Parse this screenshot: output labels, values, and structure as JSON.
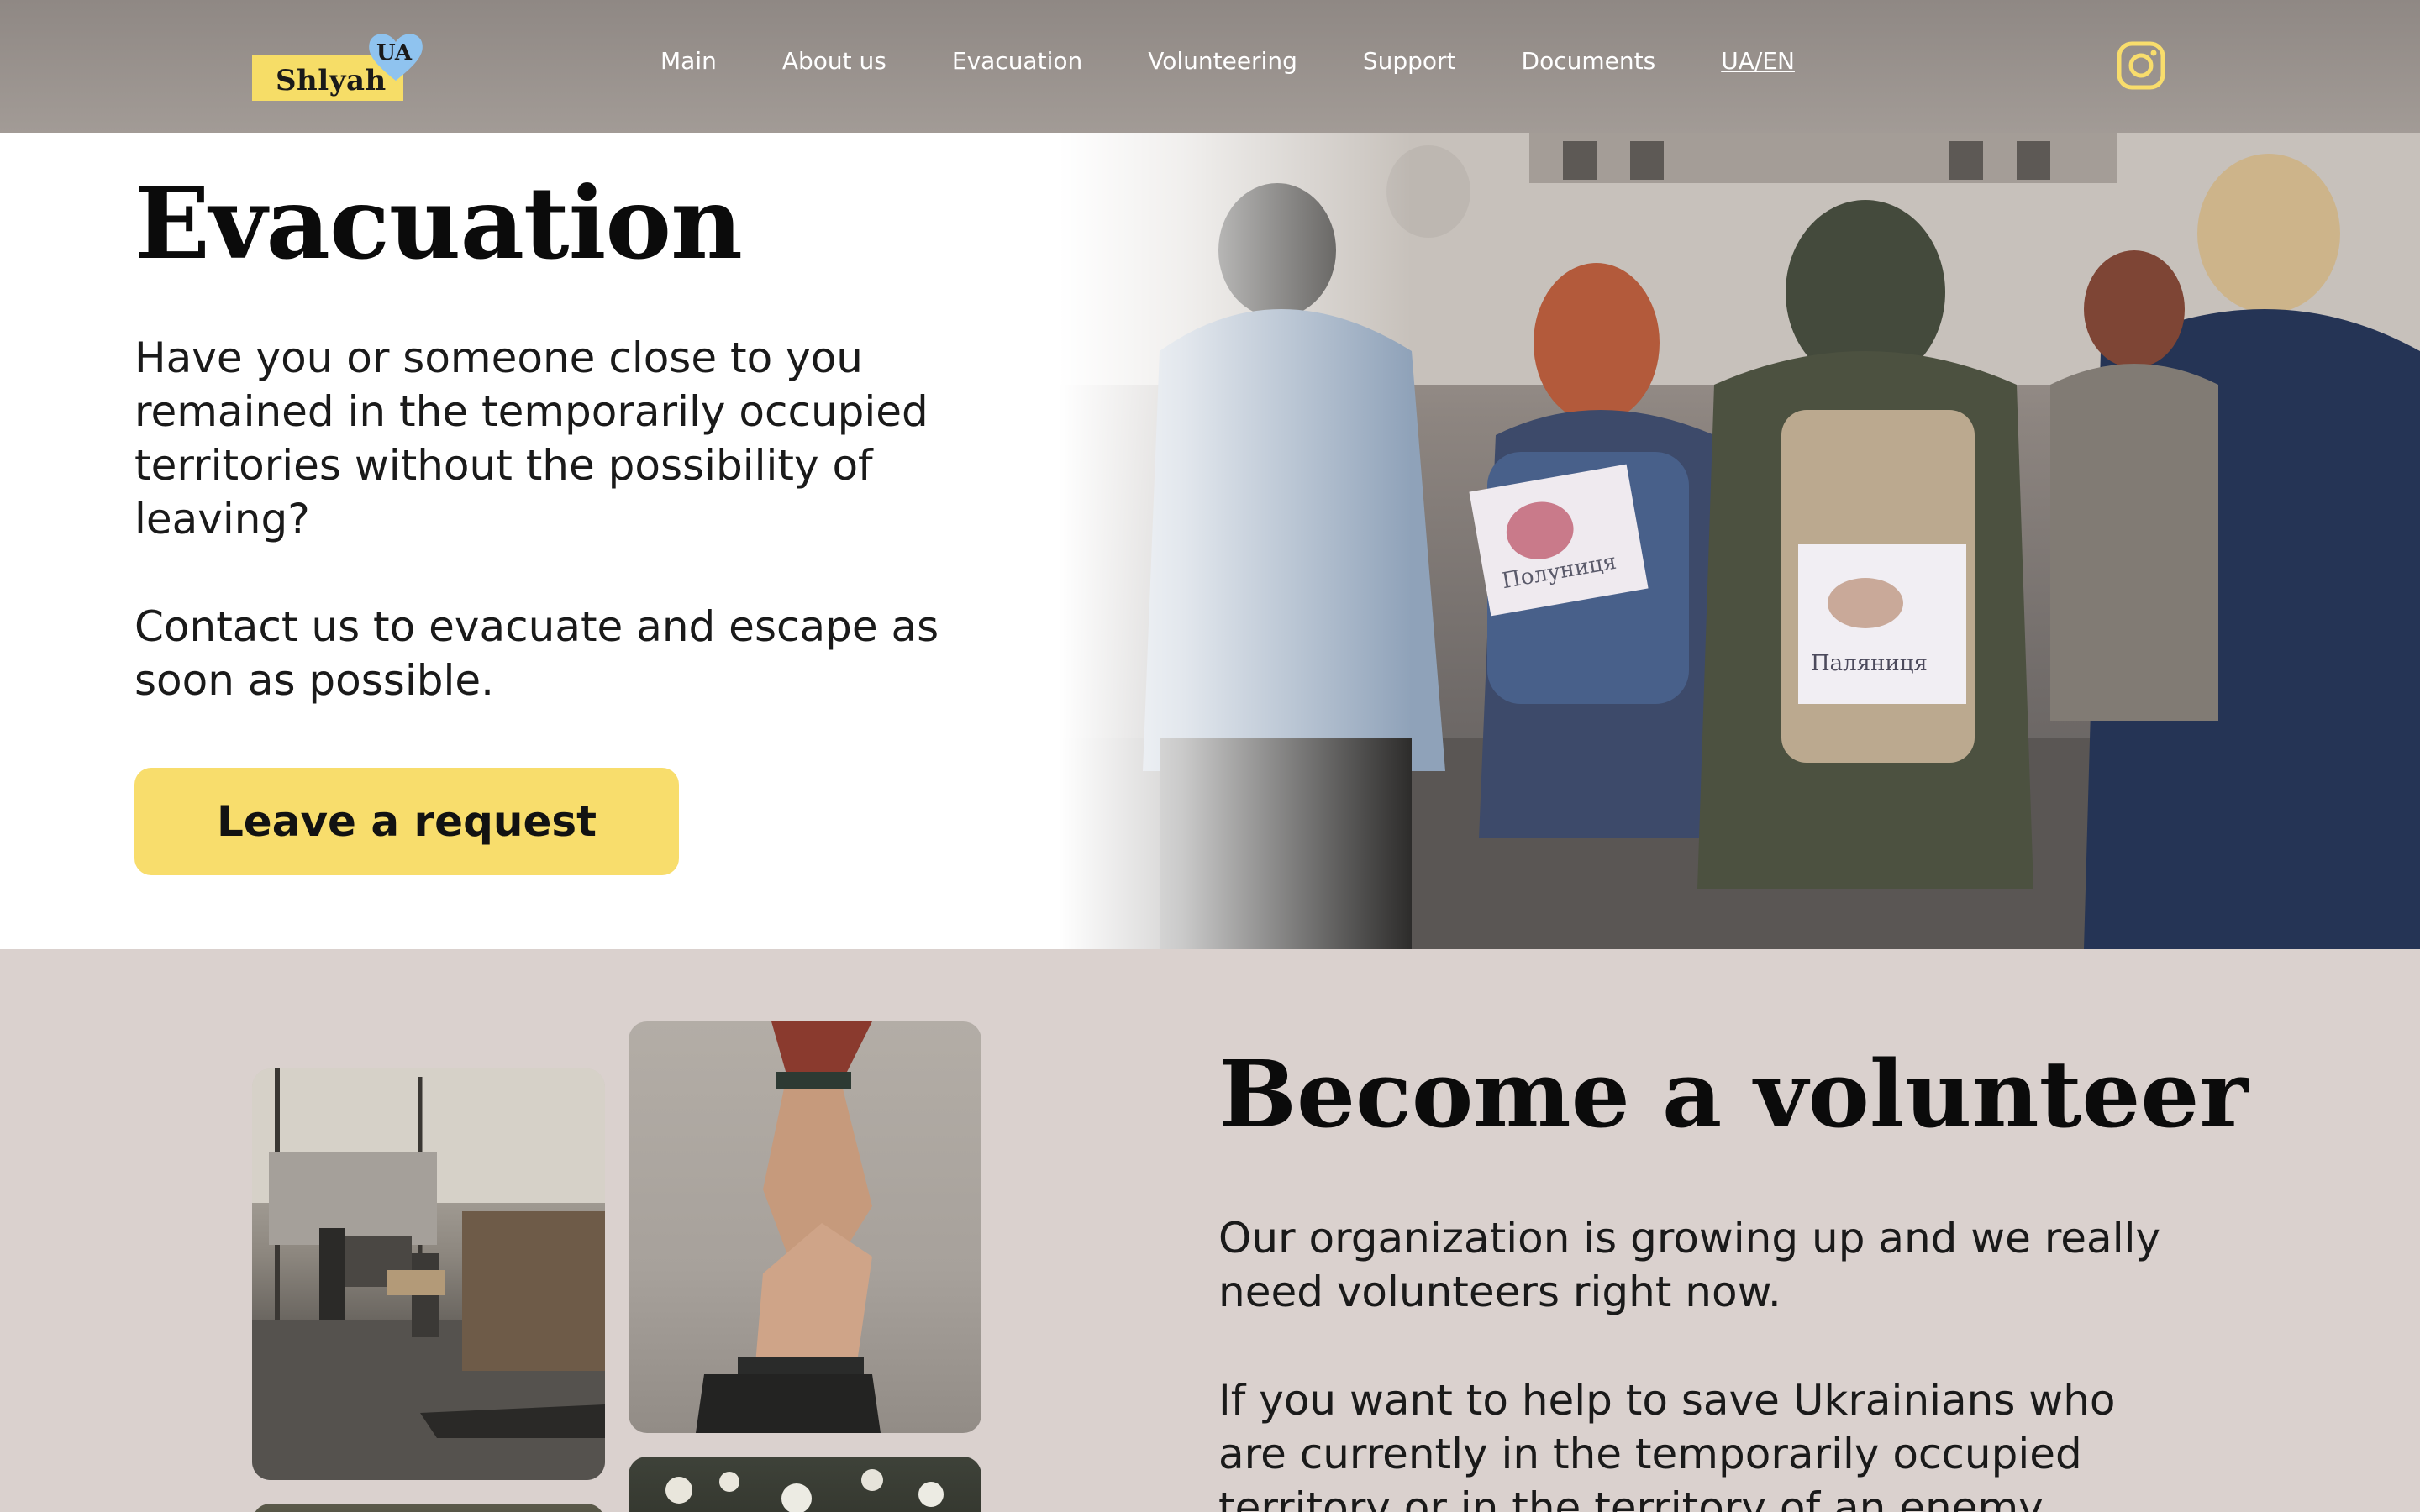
{
  "header": {
    "logo_text": "Shlyah",
    "logo_badge": "UA",
    "nav": [
      {
        "label": "Main"
      },
      {
        "label": "About us"
      },
      {
        "label": "Evacuation"
      },
      {
        "label": "Volunteering"
      },
      {
        "label": "Support"
      },
      {
        "label": "Documents"
      },
      {
        "label": "UA/EN"
      }
    ],
    "social_icon": "instagram-icon"
  },
  "hero": {
    "title": "Evacuation",
    "paragraph_1": "Have you or someone close to you remained in the temporarily occupied territories without the possibility of leaving?",
    "paragraph_2": "Contact us to evacuate and escape as soon as possible.",
    "cta_label": "Leave a request",
    "photo_sign_1": "Полуниця",
    "photo_sign_2": "Паляниця"
  },
  "volunteer": {
    "title": "Become a volunteer",
    "paragraph_1": "Our organization is growing up and we really need volunteers right now.",
    "paragraph_2": "If you want to help to save Ukrainians who are currently in the temporarily occupied territory or in the territory of an enemy"
  },
  "colors": {
    "accent_yellow": "#f8dd6c",
    "header_bg": "#958e89",
    "section_bg": "#dad1ce",
    "heart_blue": "#8fc3ef"
  }
}
